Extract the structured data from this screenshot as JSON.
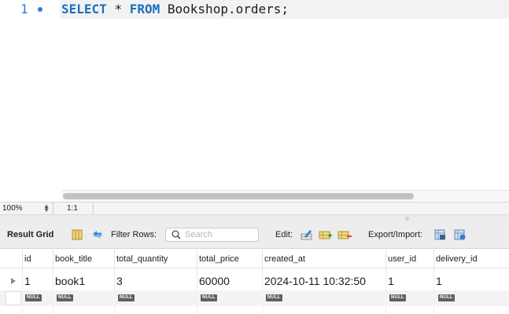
{
  "editor": {
    "line_number": "1",
    "query": {
      "select": "SELECT",
      "star": "*",
      "from": "FROM",
      "table": "Bookshop.orders;"
    }
  },
  "statusbar": {
    "zoom": "100%",
    "ratio": "1:1"
  },
  "toolbar": {
    "result_grid": "Result Grid",
    "filter_rows": "Filter Rows:",
    "search_placeholder": "Search",
    "edit": "Edit:",
    "export_import": "Export/Import:"
  },
  "grid": {
    "columns": [
      "id",
      "book_title",
      "total_quantity",
      "total_price",
      "created_at",
      "user_id",
      "delivery_id"
    ],
    "rows": [
      [
        "1",
        "book1",
        "3",
        "60000",
        "2024-10-11 10:32:50",
        "1",
        "1"
      ]
    ],
    "null_label": "NULL"
  },
  "colors": {
    "keyword": "#1b6fbf",
    "line_number": "#2a7fd4",
    "null_badge": "#5f5f5f"
  }
}
